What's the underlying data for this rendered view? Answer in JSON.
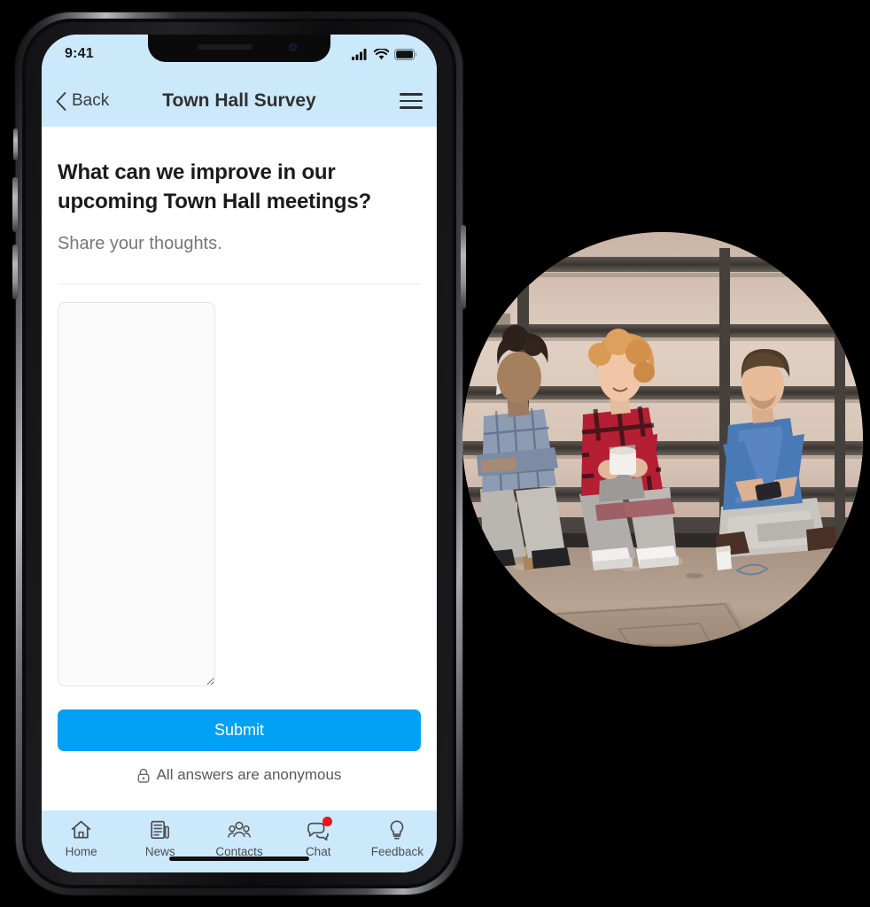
{
  "device": {
    "type": "smartphone-mockup",
    "frame_color": "#1b1b1e"
  },
  "status_bar": {
    "time": "9:41",
    "icons": [
      "signal-bars-icon",
      "wifi-icon",
      "battery-icon"
    ]
  },
  "nav": {
    "back_label": "Back",
    "title": "Town Hall Survey",
    "menu_icon": "hamburger-menu-icon"
  },
  "survey": {
    "question": "What can we improve in our upcoming Town Hall meetings?",
    "subtitle": "Share your thoughts.",
    "answer_placeholder": "",
    "answer_value": "",
    "submit_label": "Submit",
    "anonymous_note": "All answers are anonymous",
    "anonymous_icon": "lock-icon"
  },
  "tabs": [
    {
      "label": "Home",
      "icon": "home-icon",
      "badge": ""
    },
    {
      "label": "News",
      "icon": "news-icon",
      "badge": ""
    },
    {
      "label": "Contacts",
      "icon": "contacts-icon",
      "badge": ""
    },
    {
      "label": "Chat",
      "icon": "chat-icon",
      "badge": "dot"
    },
    {
      "label": "Feedback",
      "icon": "lightbulb-icon",
      "badge": ""
    }
  ],
  "photo": {
    "description": "Three workers in overalls sitting on metal shelving taking a break",
    "shape": "ellipse"
  },
  "colors": {
    "header_blue": "#cbe9fb",
    "accent_blue": "#00a0f5",
    "badge_red": "#e8141e",
    "text_dark": "#1b1b1e",
    "text_muted": "#76767b",
    "page_background": "#000000"
  }
}
